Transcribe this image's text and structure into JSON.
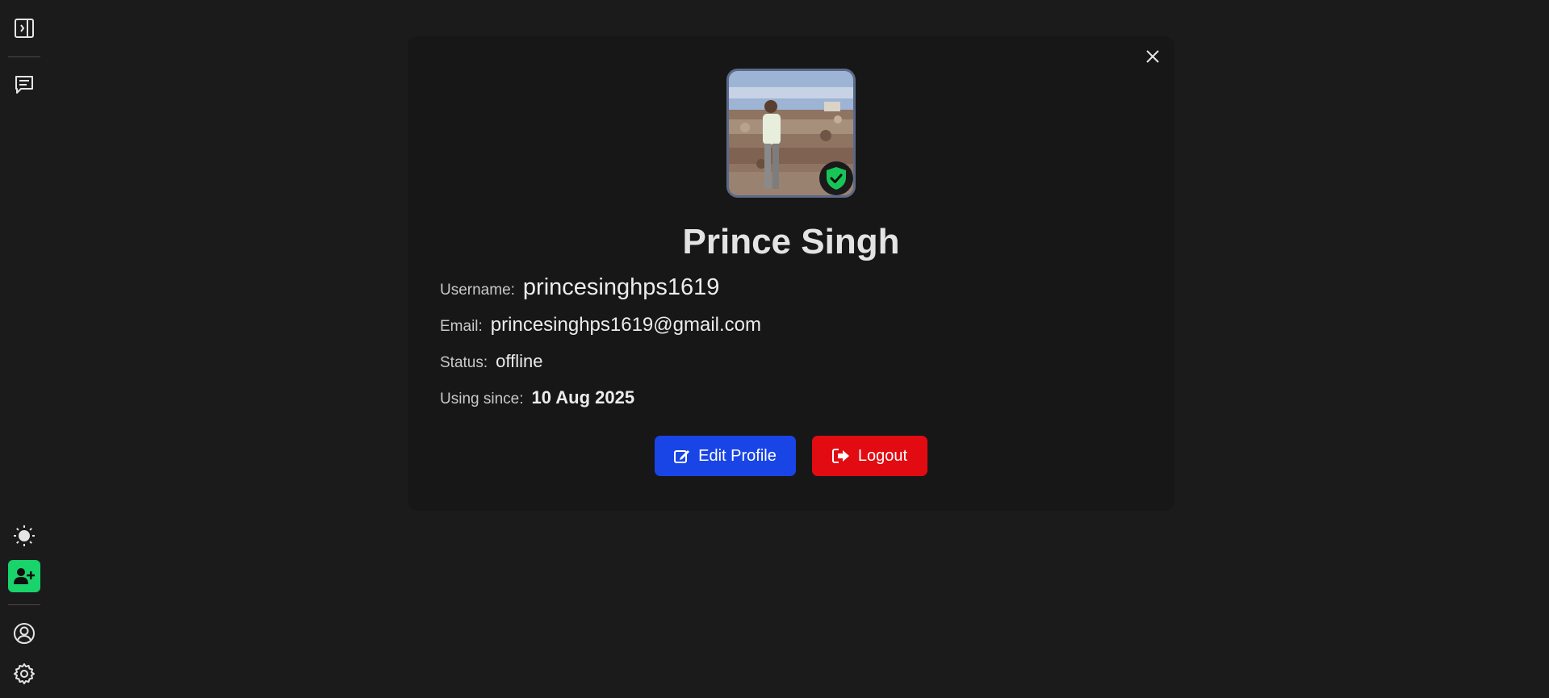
{
  "sidebar": {
    "top_icons": [
      "panel-toggle-icon",
      "chat-icon"
    ],
    "bottom_icons": [
      "sun-icon",
      "add-user-icon",
      "user-circle-icon",
      "gear-icon"
    ],
    "add_button_color": "#19d36b"
  },
  "profile": {
    "name": "Prince Singh",
    "username_label": "Username:",
    "username": "princesinghps1619",
    "email_label": "Email:",
    "email": "princesinghps1619@gmail.com",
    "status_label": "Status:",
    "status": "offline",
    "since_label": "Using since:",
    "since": "10 Aug 2025",
    "verified": true
  },
  "actions": {
    "edit_label": "Edit Profile",
    "edit_color": "#1a45e6",
    "logout_label": "Logout",
    "logout_color": "#e20b12"
  }
}
